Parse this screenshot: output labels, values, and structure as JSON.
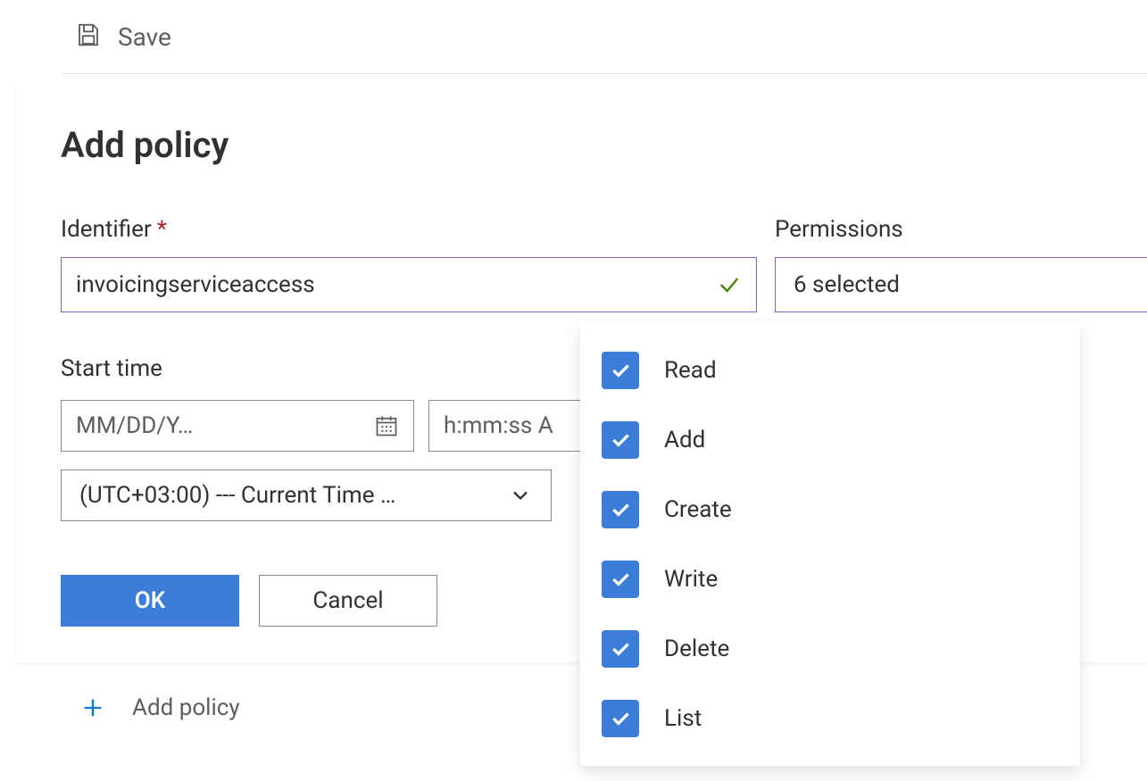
{
  "toolbar": {
    "save_label": "Save"
  },
  "panel": {
    "title": "Add policy",
    "identifier": {
      "label": "Identifier",
      "required_mark": "*",
      "value": "invoicingserviceaccess"
    },
    "start_time": {
      "label": "Start time",
      "date_placeholder": "MM/DD/Y…",
      "time_placeholder": "h:mm:ss A",
      "timezone": "(UTC+03:00) --- Current Time …"
    },
    "buttons": {
      "ok": "OK",
      "cancel": "Cancel"
    },
    "permissions": {
      "label": "Permissions",
      "summary": "6 selected",
      "options": [
        {
          "label": "Read",
          "checked": true
        },
        {
          "label": "Add",
          "checked": true
        },
        {
          "label": "Create",
          "checked": true
        },
        {
          "label": "Write",
          "checked": true
        },
        {
          "label": "Delete",
          "checked": true
        },
        {
          "label": "List",
          "checked": true
        }
      ]
    }
  },
  "behind": {
    "add_policy": "Add policy"
  }
}
